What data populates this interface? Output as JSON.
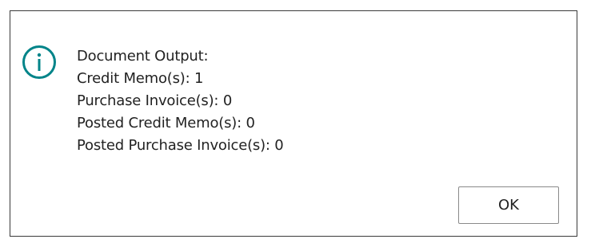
{
  "dialog": {
    "icon": "info-icon",
    "accent_color": "#008489",
    "message_lines": [
      "Document Output:",
      "Credit Memo(s): 1",
      "Purchase Invoice(s): 0",
      "Posted Credit Memo(s): 0",
      "Posted Purchase Invoice(s): 0"
    ],
    "ok_label": "OK"
  }
}
